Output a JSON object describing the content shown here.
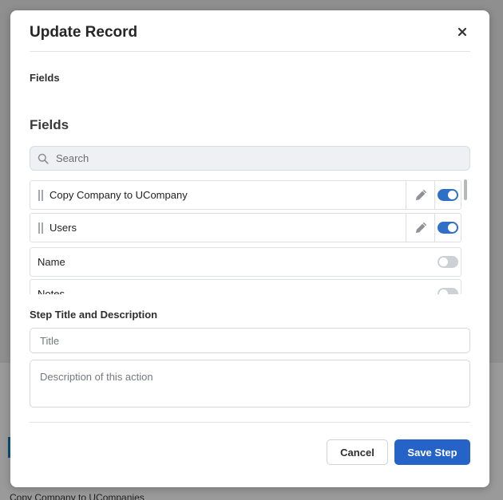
{
  "background": {
    "caption": "Copy Company to UCompanies"
  },
  "modal": {
    "title": "Update Record",
    "close_icon": "close-icon"
  },
  "fields_section": {
    "small_heading": "Fields",
    "heading": "Fields",
    "search_placeholder": "Search",
    "rows": [
      {
        "label": "Copy Company to UCompany",
        "draggable": true,
        "editable": true,
        "enabled": true
      },
      {
        "label": "Users",
        "draggable": true,
        "editable": true,
        "enabled": true
      },
      {
        "label": "Name",
        "draggable": false,
        "editable": false,
        "enabled": false
      },
      {
        "label": "Notes",
        "draggable": false,
        "editable": false,
        "enabled": false
      }
    ]
  },
  "step": {
    "heading": "Step Title and Description",
    "title_placeholder": "Title",
    "description_placeholder": "Description of this action"
  },
  "footer": {
    "cancel_label": "Cancel",
    "save_label": "Save Step"
  },
  "colors": {
    "accent": "#2563c9",
    "toggle_on": "#2e6fc7",
    "toggle_off": "#cdd1d6"
  }
}
